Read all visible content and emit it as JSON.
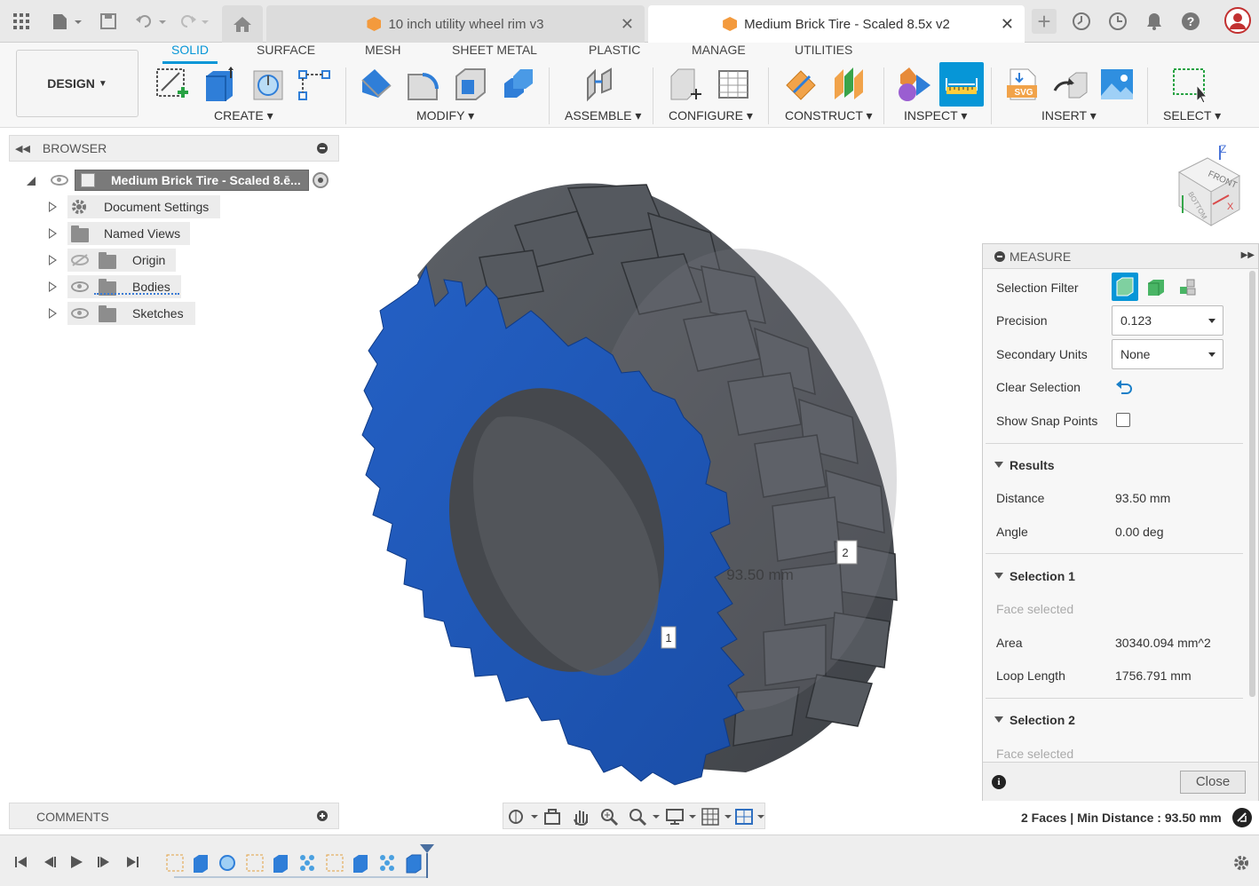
{
  "tabs": [
    {
      "label": "10 inch utility wheel rim v3",
      "active": false
    },
    {
      "label": "Medium Brick Tire - Scaled 8.5x v2",
      "active": true
    }
  ],
  "ribbon": {
    "workspace_label": "DESIGN",
    "tabs": [
      "SOLID",
      "SURFACE",
      "MESH",
      "SHEET METAL",
      "PLASTIC",
      "MANAGE",
      "UTILITIES"
    ],
    "groups": [
      "CREATE",
      "MODIFY",
      "ASSEMBLE",
      "CONFIGURE",
      "CONSTRUCT",
      "INSPECT",
      "INSERT",
      "SELECT"
    ]
  },
  "browser": {
    "title": "BROWSER",
    "root": "Medium Brick Tire - Scaled 8.ē...",
    "items": [
      {
        "label": "Document Settings"
      },
      {
        "label": "Named Views"
      },
      {
        "label": "Origin"
      },
      {
        "label": "Bodies"
      },
      {
        "label": "Sketches"
      }
    ]
  },
  "comments": {
    "title": "COMMENTS"
  },
  "viewcube": {
    "front": "FRONT",
    "bottom": "BOTTOM",
    "axis_z": "Z",
    "axis_x": "X"
  },
  "viewport": {
    "measure_label": "93.50 mm",
    "point1": "1",
    "point2": "2",
    "colors": {
      "selected_face": "#1f5bbf",
      "tire": "#4a4d52"
    }
  },
  "measure": {
    "title": "MEASURE",
    "selection_filter_label": "Selection Filter",
    "precision_label": "Precision",
    "precision_value": "0.123",
    "secondary_units_label": "Secondary Units",
    "secondary_units_value": "None",
    "clear_selection_label": "Clear Selection",
    "show_snap_points_label": "Show Snap Points",
    "results_header": "Results",
    "distance_label": "Distance",
    "distance_value": "93.50 mm",
    "angle_label": "Angle",
    "angle_value": "0.00 deg",
    "selection1_header": "Selection 1",
    "selection1_face": "Face selected",
    "area_label": "Area",
    "area_value": "30340.094 mm^2",
    "loop_length_label": "Loop Length",
    "loop_length_value": "1756.791 mm",
    "selection2_header": "Selection 2",
    "selection2_face": "Face selected",
    "close_label": "Close"
  },
  "status_text": "2 Faces | Min Distance : 93.50 mm"
}
